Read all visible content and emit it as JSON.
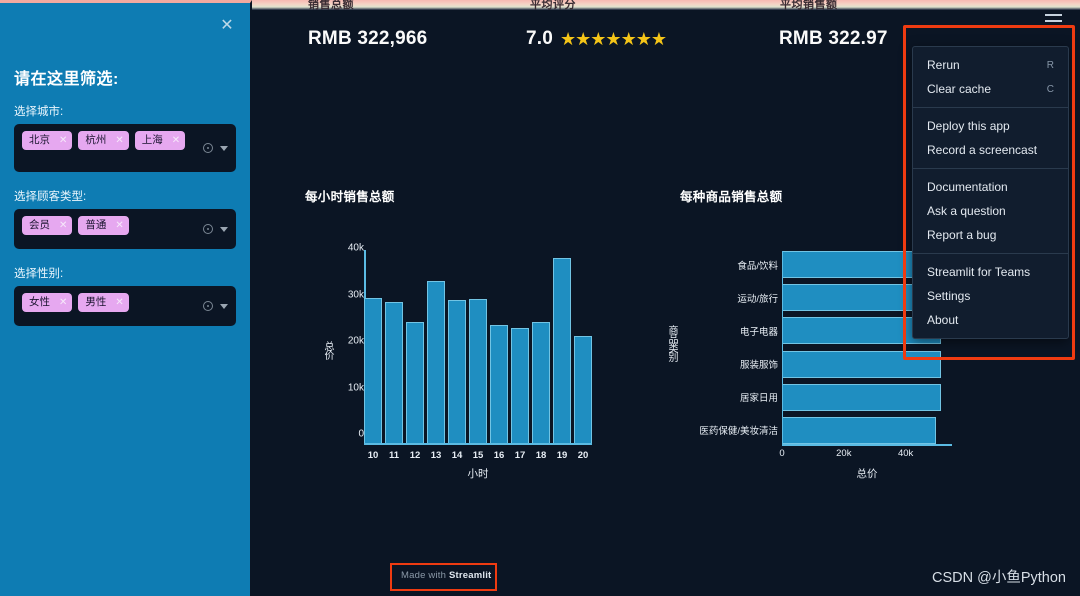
{
  "top_strip": {
    "cut_labels": [
      "销售总额",
      "平均评分",
      "平均销售额"
    ]
  },
  "sidebar": {
    "close_icon": "close-icon",
    "title": "请在这里筛选:",
    "fields": [
      {
        "label": "选择城市:",
        "chips": [
          "北京",
          "杭州",
          "上海"
        ]
      },
      {
        "label": "选择顾客类型:",
        "chips": [
          "会员",
          "普通"
        ]
      },
      {
        "label": "选择性别:",
        "chips": [
          "女性",
          "男性"
        ]
      }
    ],
    "chip_remove_icon": "×",
    "accent": "#0e7cb3",
    "chip_color": "#e6a8f0"
  },
  "metrics": [
    {
      "value": "RMB 322,966"
    },
    {
      "value": "7.0",
      "stars": "★★★★★★★"
    },
    {
      "value": "RMB 322.97"
    }
  ],
  "chart_data": [
    {
      "type": "bar",
      "title": "每小时销售总额",
      "xlabel": "小时",
      "ylabel": "总价",
      "categories": [
        "10",
        "11",
        "12",
        "13",
        "14",
        "15",
        "16",
        "17",
        "18",
        "19",
        "20"
      ],
      "values": [
        31200,
        30300,
        26100,
        34800,
        30700,
        31000,
        25400,
        24700,
        26100,
        39800,
        23100
      ],
      "ylim": [
        0,
        42000
      ],
      "yticks": [
        "0",
        "10k",
        "20k",
        "30k",
        "40k"
      ],
      "ytick_values": [
        0,
        10000,
        20000,
        30000,
        40000
      ],
      "grid": false,
      "bar_color": "#1f8ec1"
    },
    {
      "type": "bar",
      "orientation": "horizontal",
      "title": "每种商品销售总额",
      "xlabel": "总价",
      "ylabel": "商品类别",
      "categories": [
        "食品/饮料",
        "运动/旅行",
        "电子电器",
        "服装服饰",
        "居家日用",
        "医药保健/美妆清洁"
      ],
      "values": [
        51000,
        51000,
        51000,
        51000,
        51000,
        49500
      ],
      "xlim": [
        0,
        55000
      ],
      "xticks": [
        "0",
        "20k",
        "40k"
      ],
      "xtick_values": [
        0,
        20000,
        40000
      ],
      "grid": false,
      "bar_color": "#1f8ec1"
    }
  ],
  "menu": {
    "hamburger_icon": "hamburger-icon",
    "groups": [
      [
        {
          "label": "Rerun",
          "shortcut": "R"
        },
        {
          "label": "Clear cache",
          "shortcut": "C"
        }
      ],
      [
        {
          "label": "Deploy this app",
          "shortcut": ""
        },
        {
          "label": "Record a screencast",
          "shortcut": ""
        }
      ],
      [
        {
          "label": "Documentation",
          "shortcut": ""
        },
        {
          "label": "Ask a question",
          "shortcut": ""
        },
        {
          "label": "Report a bug",
          "shortcut": ""
        }
      ],
      [
        {
          "label": "Streamlit for Teams",
          "shortcut": ""
        },
        {
          "label": "Settings",
          "shortcut": ""
        },
        {
          "label": "About",
          "shortcut": ""
        }
      ]
    ],
    "highlight_color": "#ef3b11"
  },
  "footer": {
    "made_with": "Made with ",
    "brand": "Streamlit",
    "watermark": "CSDN @小鱼Python"
  }
}
